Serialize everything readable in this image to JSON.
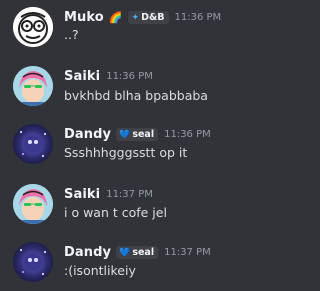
{
  "messages": [
    {
      "author": "Muko",
      "emoji": "🌈",
      "tag": "D&B",
      "time": "11:36 PM",
      "text": "..?"
    },
    {
      "author": "Saiki",
      "time": "11:36 PM",
      "text": "bvkhbd blha bpabbaba"
    },
    {
      "author": "Dandy",
      "badge": "seal",
      "time": "11:36 PM",
      "text": "Ssshhhgggsstt op it"
    },
    {
      "author": "Saiki",
      "time": "11:37 PM",
      "text": "i o wan t cofe jel"
    },
    {
      "author": "Dandy",
      "badge": "seal",
      "time": "11:37 PM",
      "text": ":(isontlikeiy"
    }
  ],
  "colors": {
    "background": "#313338",
    "username": "#f2f3f5",
    "timestamp": "#949ba4",
    "message_text": "#dbdee1",
    "badge_bg": "#3f4147"
  },
  "icons": {
    "tag": "diamond-icon",
    "badge": "heart-icon"
  }
}
